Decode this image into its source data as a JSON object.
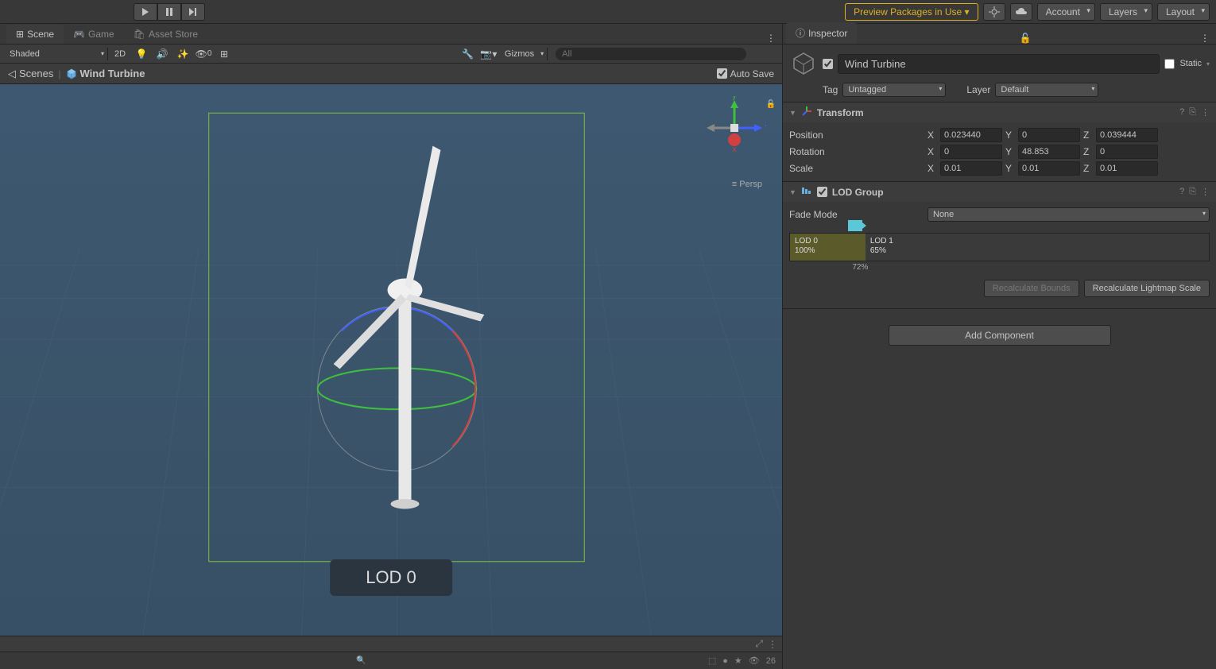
{
  "topbar": {
    "preview_label": "Preview Packages in Use ▾",
    "account": "Account",
    "layers": "Layers",
    "layout": "Layout"
  },
  "tabs": {
    "scene": "Scene",
    "game": "Game",
    "asset_store": "Asset Store"
  },
  "scene_toolbar": {
    "shading": "Shaded",
    "twod": "2D",
    "hidden_count": "0",
    "gizmos": "Gizmos",
    "search_placeholder": "All"
  },
  "breadcrumb": {
    "scenes": "Scenes",
    "object": "Wind Turbine",
    "auto_save": "Auto Save"
  },
  "viewport": {
    "persp": "Persp",
    "lod_label": "LOD 0"
  },
  "bottom": {
    "hidden": "26"
  },
  "inspector": {
    "title": "Inspector",
    "object_name": "Wind Turbine",
    "static": "Static",
    "tag_label": "Tag",
    "tag_value": "Untagged",
    "layer_label": "Layer",
    "layer_value": "Default"
  },
  "transform": {
    "title": "Transform",
    "position_label": "Position",
    "rotation_label": "Rotation",
    "scale_label": "Scale",
    "pos": {
      "x": "0.023440",
      "y": "0",
      "z": "0.039444"
    },
    "rot": {
      "x": "0",
      "y": "48.853",
      "z": "0"
    },
    "scale": {
      "x": "0.01",
      "y": "0.01",
      "z": "0.01"
    }
  },
  "lodgroup": {
    "title": "LOD Group",
    "fade_mode_label": "Fade Mode",
    "fade_mode_value": "None",
    "lod0_label": "LOD 0",
    "lod0_pct": "100%",
    "lod1_label": "LOD 1",
    "lod1_pct": "65%",
    "camera_pct": "72%",
    "recalc_bounds": "Recalculate Bounds",
    "recalc_lightmap": "Recalculate Lightmap Scale"
  },
  "add_component": "Add Component"
}
